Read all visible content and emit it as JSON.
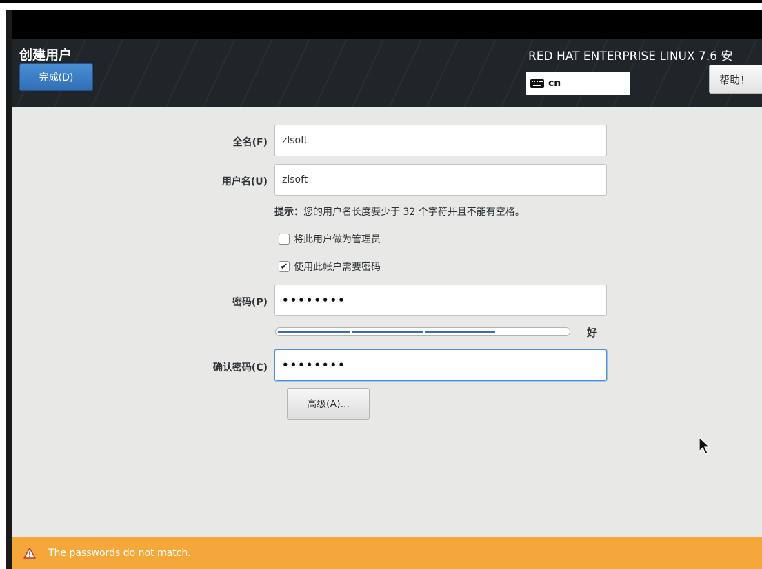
{
  "header": {
    "spoke_title": "创建用户",
    "done_label": "完成(D)",
    "product_title": "RED HAT ENTERPRISE LINUX 7.6 安",
    "keyboard_layout": "cn",
    "help_label": "帮助！"
  },
  "form": {
    "fullname_label": "全名(F)",
    "fullname_value": "zlsoft",
    "username_label": "用户名(U)",
    "username_value": "zlsoft",
    "hint_prefix": "提示：",
    "hint_text": "您的用户名长度要少于 32 个字符并且不能有空格。",
    "admin_checkbox_label": "将此用户做为管理员",
    "admin_checked": false,
    "require_password_label": "使用此帐户需要密码",
    "require_password_checked": true,
    "password_label": "密码(P)",
    "password_value": "••••••••",
    "strength_level": 0.75,
    "strength_label": "好",
    "confirm_label": "确认密码(C)",
    "confirm_value": "••••••••",
    "advanced_label": "高级(A)..."
  },
  "warning": {
    "message": "The passwords do not match.",
    "icon": "warning-icon",
    "color": "#f5a73a"
  },
  "colors": {
    "accent": "#3b6fa8",
    "done_button": "#3a7bc8"
  }
}
